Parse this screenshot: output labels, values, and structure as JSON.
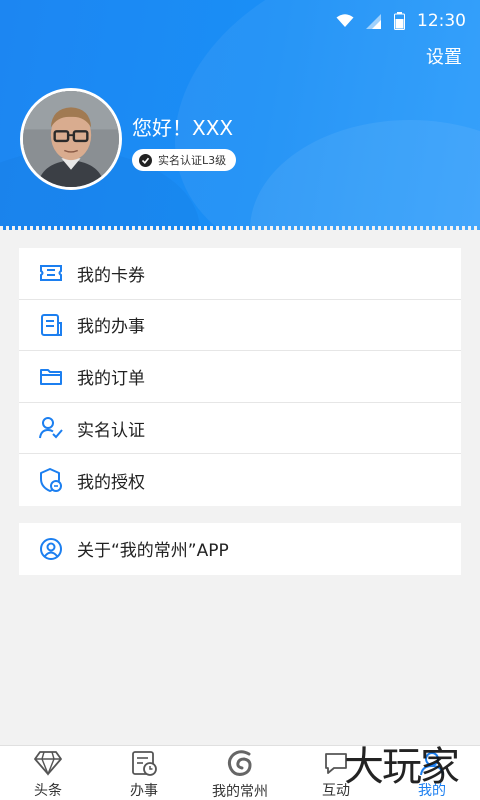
{
  "status_bar": {
    "time": "12:30",
    "icons": [
      "wifi-icon",
      "signal-icon",
      "battery-icon"
    ]
  },
  "header": {
    "settings_label": "设置",
    "greeting": "您好！XXX",
    "verification_badge": "实名认证L3级"
  },
  "menu": {
    "items": [
      {
        "label": "我的卡券",
        "icon": "ticket-icon"
      },
      {
        "label": "我的办事",
        "icon": "document-icon"
      },
      {
        "label": "我的订单",
        "icon": "folder-icon"
      },
      {
        "label": "实名认证",
        "icon": "user-verified-icon"
      },
      {
        "label": "我的授权",
        "icon": "shield-icon"
      }
    ]
  },
  "about": {
    "label": "关于“我的常州”APP",
    "icon": "person-circle-icon"
  },
  "tabbar": {
    "tabs": [
      {
        "label": "头条",
        "icon": "diamond-icon",
        "active": false
      },
      {
        "label": "办事",
        "icon": "calendar-clock-icon",
        "active": false
      },
      {
        "label": "我的常州",
        "icon": "swirl-logo-icon",
        "active": false
      },
      {
        "label": "互动",
        "icon": "chat-icon",
        "active": false
      },
      {
        "label": "我的",
        "icon": "profile-icon",
        "active": true
      }
    ]
  },
  "watermark": "大玩家",
  "colors": {
    "brand_blue": "#1a8ff6",
    "icon_blue": "#1c7ff0",
    "background": "#f2f2f2"
  }
}
